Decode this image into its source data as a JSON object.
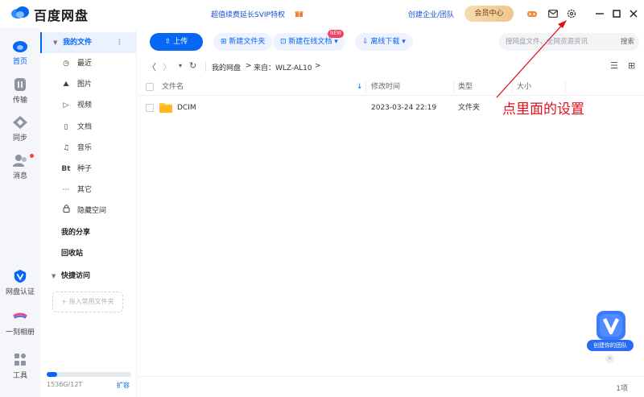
{
  "app": {
    "title": "百度网盘",
    "promo": "超值续费延长SVIP特权",
    "business": "创建企业/团队",
    "vip_center": "会员中心"
  },
  "rail": {
    "items": [
      {
        "label": "首页",
        "icon": "cloud-home-icon",
        "active": true
      },
      {
        "label": "传输",
        "icon": "transfer-icon"
      },
      {
        "label": "同步",
        "icon": "sync-icon"
      },
      {
        "label": "消息",
        "icon": "message-icon"
      },
      {
        "label": "网盘认证",
        "icon": "certify-icon"
      },
      {
        "label": "一刻相册",
        "icon": "album-icon"
      },
      {
        "label": "工具",
        "icon": "tools-icon"
      }
    ]
  },
  "nav": {
    "my_files": "我的文件",
    "items": [
      {
        "label": "最近",
        "icon": "clock-icon",
        "glyph": "◷"
      },
      {
        "label": "图片",
        "icon": "image-icon",
        "glyph": "⛰"
      },
      {
        "label": "视频",
        "icon": "video-icon",
        "glyph": "▷"
      },
      {
        "label": "文档",
        "icon": "document-icon",
        "glyph": "▯"
      },
      {
        "label": "音乐",
        "icon": "music-icon",
        "glyph": "♫"
      },
      {
        "label": "种子",
        "icon": "bt-icon",
        "glyph": "Bt"
      },
      {
        "label": "其它",
        "icon": "more-icon",
        "glyph": "⋯"
      },
      {
        "label": "隐藏空间",
        "icon": "lock-icon",
        "glyph": "🔒"
      }
    ],
    "my_share": "我的分享",
    "recycle": "回收站",
    "quick_access": "快捷访问",
    "drag_hint": "+ 拖入常用文件夹",
    "quota": "1536G/12T",
    "quota_used": 0.12,
    "expand": "扩容"
  },
  "toolbar": {
    "upload": "上传",
    "new_folder": "新建文件夹",
    "new_online_doc": "新建在线文档",
    "new_badge": "NEW",
    "offline_download": "离线下载",
    "search_placeholder": "搜网盘文件、全网资源资讯",
    "search": "搜索"
  },
  "path": {
    "root": "我的网盘",
    "sep1": ">",
    "source": "来自：WLZ-AL10",
    "sep2": ">"
  },
  "table": {
    "headers": {
      "name": "文件名",
      "modified": "修改时间",
      "type": "类型",
      "size": "大小"
    },
    "rows": [
      {
        "name": "DCIM",
        "modified": "2023-03-24 22:19",
        "type": "文件夹",
        "size": ""
      }
    ]
  },
  "annotation": "点里面的设置",
  "team_widget": {
    "label": "创建你的团队",
    "close": "×"
  },
  "footer": {
    "count": "1项"
  },
  "colors": {
    "accent": "#0667f5",
    "annotation": "#e0101d"
  }
}
